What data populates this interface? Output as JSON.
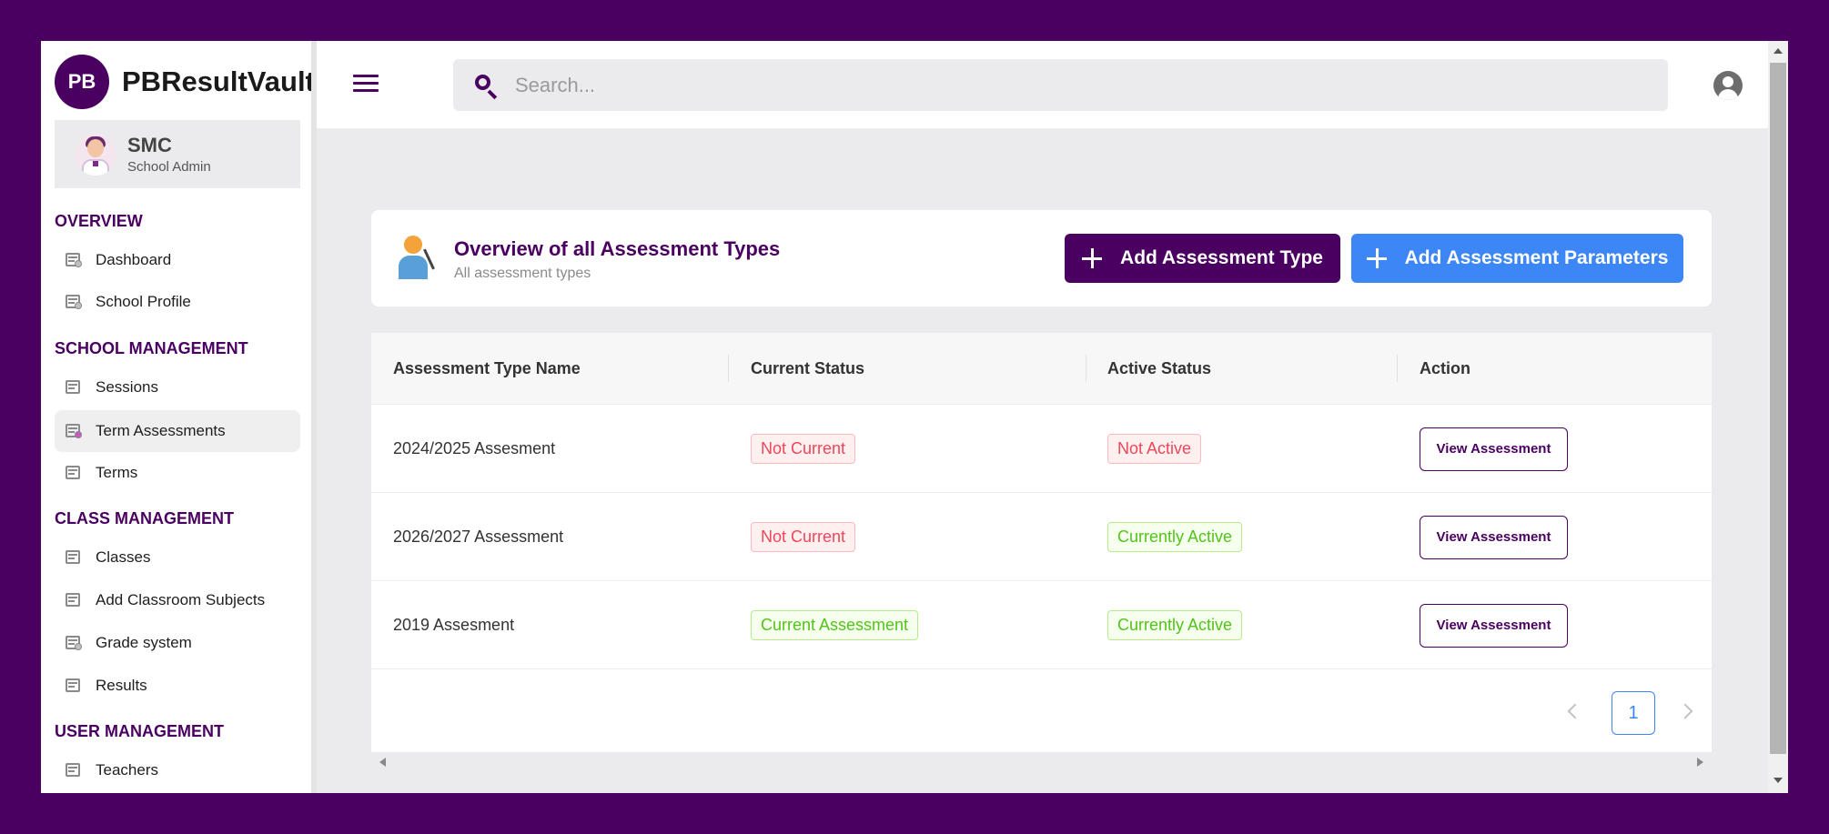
{
  "brand": {
    "logo_text": "PB",
    "name": "PBResultVault",
    "color": "#4a0060"
  },
  "user": {
    "name": "SMC",
    "role": "School Admin"
  },
  "sidebar": {
    "sections": [
      {
        "title": "OVERVIEW",
        "items": [
          {
            "label": "Dashboard",
            "icon": "dashboard-icon"
          },
          {
            "label": "School Profile",
            "icon": "school-profile-icon"
          }
        ]
      },
      {
        "title": "SCHOOL MANAGEMENT",
        "items": [
          {
            "label": "Sessions",
            "icon": "calendar-icon"
          },
          {
            "label": "Term Assessments",
            "icon": "assessment-icon",
            "active": true
          },
          {
            "label": "Terms",
            "icon": "calendar-icon"
          }
        ]
      },
      {
        "title": "CLASS MANAGEMENT",
        "items": [
          {
            "label": "Classes",
            "icon": "classroom-icon"
          },
          {
            "label": "Add Classroom Subjects",
            "icon": "subjects-icon"
          },
          {
            "label": "Grade system",
            "icon": "grade-icon"
          },
          {
            "label": "Results",
            "icon": "results-icon"
          }
        ]
      },
      {
        "title": "USER MANAGEMENT",
        "items": [
          {
            "label": "Teachers",
            "icon": "teacher-icon"
          }
        ]
      }
    ]
  },
  "topbar": {
    "search_placeholder": "Search..."
  },
  "page": {
    "title": "Overview of all Assessment Types",
    "subtitle": "All assessment types",
    "add_type_label": "Add Assessment Type",
    "add_params_label": "Add Assessment Parameters"
  },
  "table": {
    "columns": [
      "Assessment Type Name",
      "Current Status",
      "Active Status",
      "Action"
    ],
    "rows": [
      {
        "name": "2024/2025 Assesment",
        "current": "Not Current",
        "current_color": "red",
        "active": "Not Active",
        "active_color": "red",
        "action": "View Assessment"
      },
      {
        "name": "2026/2027 Assessment",
        "current": "Not Current",
        "current_color": "red",
        "active": "Currently Active",
        "active_color": "green",
        "action": "View Assessment"
      },
      {
        "name": "2019 Assesment",
        "current": "Current Assessment",
        "current_color": "green",
        "active": "Currently Active",
        "active_color": "green",
        "action": "View Assessment"
      }
    ]
  },
  "pagination": {
    "current_page": "1"
  },
  "colors": {
    "primary": "#4a0060",
    "accent_blue": "#3d86f5",
    "status_red": "#f0455a",
    "status_green": "#52c41a"
  }
}
